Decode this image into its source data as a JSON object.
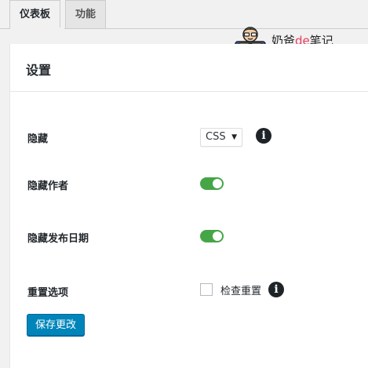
{
  "tabs": [
    {
      "label": "仪表板",
      "active": true
    },
    {
      "label": "功能",
      "active": false
    }
  ],
  "brand": {
    "text_pre": "奶爸",
    "text_de": "de",
    "text_post": "笔记",
    "de_color": "#e83c5a",
    "icon": "avatar-mascot-icon"
  },
  "panel": {
    "title": "设置"
  },
  "settings": {
    "hide": {
      "label": "隐藏",
      "select_value": "CSS",
      "info_icon": "info-icon"
    },
    "hide_author": {
      "label": "隐藏作者",
      "enabled": true
    },
    "hide_date": {
      "label": "隐藏发布日期",
      "enabled": true
    },
    "reset": {
      "label": "重置选项",
      "checkbox_label": "检查重置",
      "checked": false,
      "info_icon": "info-icon"
    }
  },
  "actions": {
    "save_label": "保存更改",
    "accent": "#0085ba"
  },
  "colors": {
    "toggle_on": "#46a546"
  }
}
